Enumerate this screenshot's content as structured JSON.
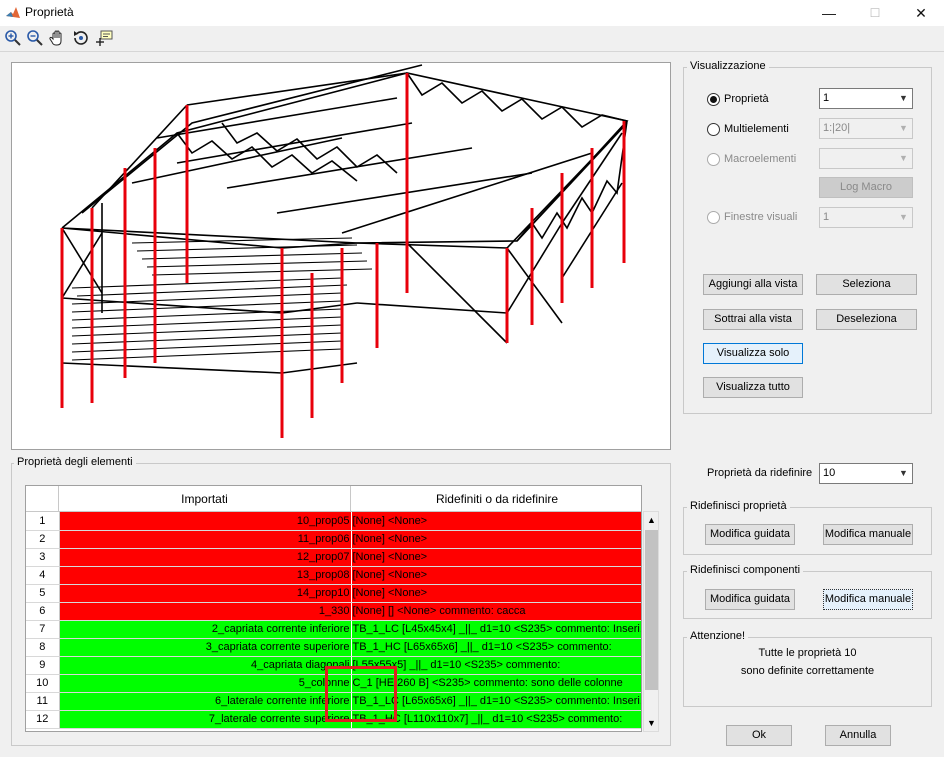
{
  "window": {
    "title": "Proprietà",
    "min": "—",
    "max": "☐",
    "close": "✕"
  },
  "toolbar": {
    "zoom_in": "🔍",
    "zoom_out": "🔍",
    "pan": "✋",
    "rotate": "⟲",
    "datacursor": "⌖"
  },
  "visualizzazione": {
    "title": "Visualizzazione",
    "proprieta_label": "Proprietà",
    "proprieta_value": "1",
    "multielementi_label": "Multielementi",
    "multielementi_value": "1:|20|",
    "macroelementi_label": "Macroelementi",
    "macroelementi_value": "",
    "log_macro": "Log Macro",
    "finestre_label": "Finestre visuali",
    "finestre_value": "1",
    "aggiungi": "Aggiungi alla vista",
    "seleziona": "Seleziona",
    "sottrai": "Sottrai alla vista",
    "deseleziona": "Deseleziona",
    "visualizza_solo": "Visualizza solo",
    "visualizza_tutto": "Visualizza tutto"
  },
  "prop_elementi": {
    "title": "Proprietà degli elementi",
    "col_importati": "Importati",
    "col_ridefiniti": "Ridefiniti o da ridefinire",
    "rows": [
      {
        "n": "1",
        "imp": "10_prop05",
        "rid": "[None]  <None>",
        "status": "red"
      },
      {
        "n": "2",
        "imp": "11_prop06",
        "rid": "[None]  <None>",
        "status": "red"
      },
      {
        "n": "3",
        "imp": "12_prop07",
        "rid": "[None]  <None>",
        "status": "red"
      },
      {
        "n": "4",
        "imp": "13_prop08",
        "rid": "[None]  <None>",
        "status": "red"
      },
      {
        "n": "5",
        "imp": "14_prop10",
        "rid": "[None]  <None>",
        "status": "red"
      },
      {
        "n": "6",
        "imp": "1_330",
        "rid": "[None] [] <None> commento: cacca",
        "status": "red"
      },
      {
        "n": "7",
        "imp": "2_capriata corrente inferiore",
        "rid": "TB_1_LC  [L45x45x4]  _||_  d1=10 <S235> commento: Inseri...",
        "status": "green"
      },
      {
        "n": "8",
        "imp": "3_capriata corrente superiore",
        "rid": "TB_1_HC  [L65x65x6]  _||_  d1=10 <S235> commento:",
        "status": "green"
      },
      {
        "n": "9",
        "imp": "4_capriata diagonali",
        "rid": "[L55x55x5]  _||_  d1=10 <S235> commento:",
        "status": "green"
      },
      {
        "n": "10",
        "imp": "5_colonne",
        "rid": "C_1  [HE 260 B]  <S235> commento: sono delle colonne",
        "status": "green"
      },
      {
        "n": "11",
        "imp": "6_laterale corrente inferiore",
        "rid": "TB_1_LC  [L65x65x6]  _||_  d1=10 <S235> commento: Inseri...",
        "status": "green"
      },
      {
        "n": "12",
        "imp": "7_laterale corrente superiore",
        "rid": "TB_1_HC  [L110x110x7]  _||_  d1=10 <S235> commento:",
        "status": "green"
      }
    ]
  },
  "ridefinire": {
    "label": "Proprietà da ridefinire",
    "value": "10"
  },
  "ridefinisci_proprieta": {
    "title": "Ridefinisci proprietà",
    "guidata": "Modifica guidata",
    "manuale": "Modifica manuale"
  },
  "ridefinisci_componenti": {
    "title": "Ridefinisci componenti",
    "guidata": "Modifica guidata",
    "manuale": "Modifica manuale"
  },
  "attenzione": {
    "title": "Attenzione!",
    "line1": "Tutte le proprietà 10",
    "line2": "sono definite correttamente"
  },
  "ok": "Ok",
  "annulla": "Annulla",
  "colors": {
    "red": "#ff0000",
    "green": "#00ff00",
    "accent": "#0078d7"
  }
}
